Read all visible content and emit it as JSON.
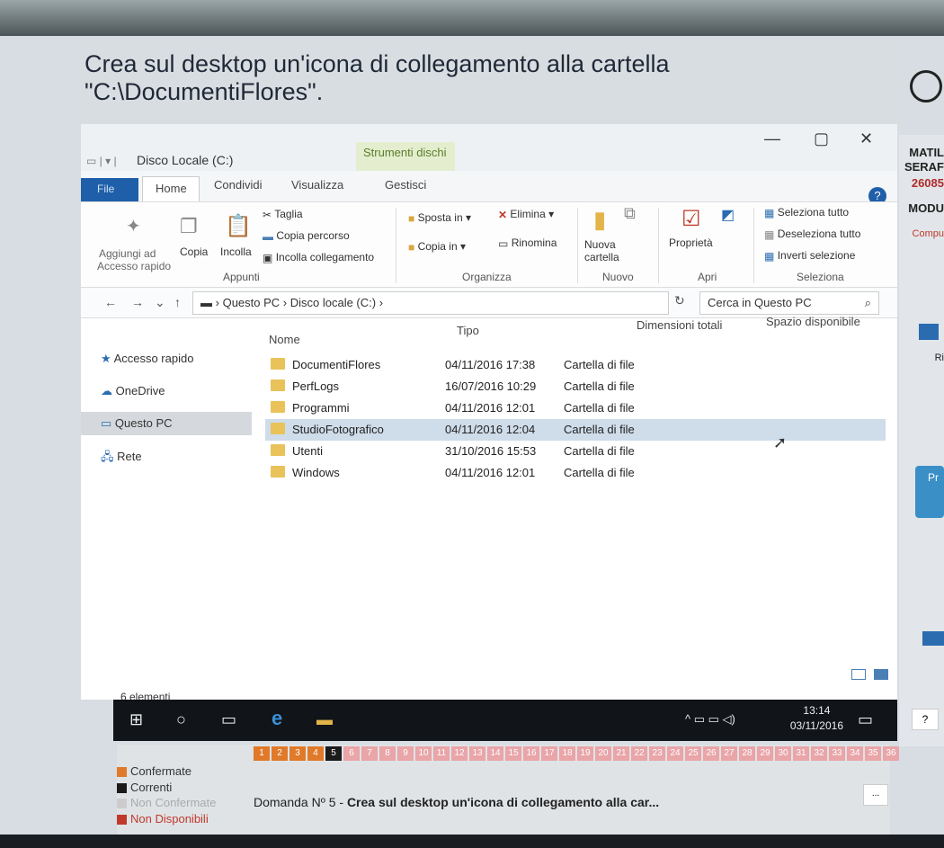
{
  "question": {
    "text": "Crea sul desktop un'icona di collegamento alla cartella \"C:\\DocumentiFlores\"."
  },
  "right_panel": {
    "line1": "MATIL",
    "line2": "SERAF",
    "line3": "26085",
    "line4": "MODU",
    "line5": "Compu",
    "line6": "Ri",
    "line7": "Pr"
  },
  "window": {
    "title": "Disco Locale (C:)",
    "tool_tab": "Strumenti dischi",
    "tabs": {
      "file": "File",
      "home": "Home",
      "share": "Condividi",
      "view": "Visualizza",
      "manage": "Gestisci"
    },
    "controls": {
      "minimize": "—",
      "maximize": "▢",
      "close": "✕"
    }
  },
  "ribbon": {
    "clipboard": {
      "pin": "Aggiungi ad",
      "pin2": "Accesso rapido",
      "copy": "Copia",
      "paste": "Incolla",
      "cut": "Taglia",
      "copy_path": "Copia percorso",
      "paste_link": "Incolla collegamento",
      "group": "Appunti"
    },
    "organize": {
      "move": "Sposta in ▾",
      "copy_to": "Copia in ▾",
      "delete": "Elimina ▾",
      "rename": "Rinomina",
      "group": "Organizza"
    },
    "new": {
      "new_folder": "Nuova",
      "new_folder2": "cartella",
      "group": "Nuovo"
    },
    "open": {
      "properties": "Proprietà",
      "group": "Apri"
    },
    "select": {
      "all": "Seleziona tutto",
      "none": "Deseleziona tutto",
      "invert": "Inverti selezione",
      "group": "Seleziona"
    }
  },
  "address": {
    "path1": "Questo PC",
    "path2": "Disco locale (C:)",
    "search_placeholder": "Cerca in Questo PC"
  },
  "columns": {
    "name": "Nome",
    "type": "Tipo",
    "total": "Dimensioni totali",
    "free": "Spazio disponibile"
  },
  "nav": [
    "Accesso rapido",
    "OneDrive",
    "Questo PC",
    "Rete"
  ],
  "files": [
    {
      "name": "DocumentiFlores",
      "date": "04/11/2016 17:38",
      "type": "Cartella di file"
    },
    {
      "name": "PerfLogs",
      "date": "16/07/2016 10:29",
      "type": "Cartella di file"
    },
    {
      "name": "Programmi",
      "date": "04/11/2016 12:01",
      "type": "Cartella di file"
    },
    {
      "name": "StudioFotografico",
      "date": "04/11/2016 12:04",
      "type": "Cartella di file"
    },
    {
      "name": "Utenti",
      "date": "31/10/2016 15:53",
      "type": "Cartella di file"
    },
    {
      "name": "Windows",
      "date": "04/11/2016 12:01",
      "type": "Cartella di file"
    }
  ],
  "status": "6 elementi",
  "taskbar": {
    "time": "13:14",
    "date": "03/11/2016"
  },
  "bottom": {
    "legend": {
      "confirmed": "Confermate",
      "current": "Correnti",
      "unconfirmed": "Non Confermate",
      "unavailable": "Non Disponibili"
    },
    "numbers": [
      "1",
      "2",
      "3",
      "4",
      "5",
      "6",
      "7",
      "8",
      "9",
      "10",
      "11",
      "12",
      "13",
      "14",
      "15",
      "16",
      "17",
      "18",
      "19",
      "20",
      "21",
      "22",
      "23",
      "24",
      "25",
      "26",
      "27",
      "28",
      "29",
      "30",
      "31",
      "32",
      "33",
      "34",
      "35",
      "36"
    ],
    "question_label": "Domanda Nº 5 -",
    "question_text": "Crea sul desktop un'icona di collegamento alla car...",
    "next": "...",
    "help": "?"
  }
}
